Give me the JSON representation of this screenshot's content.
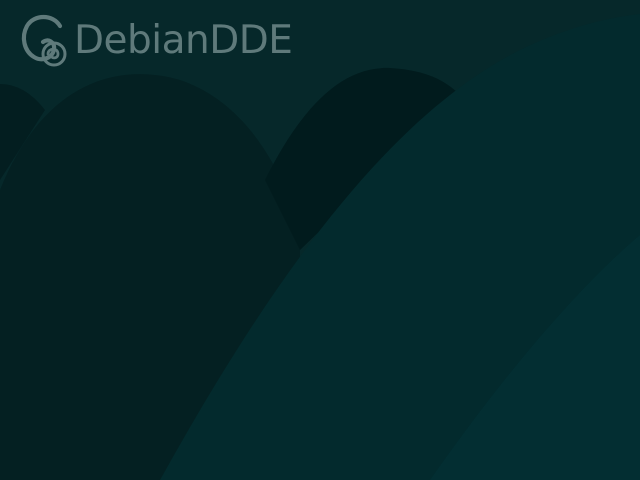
{
  "brand": {
    "name": "DebianDDE",
    "logo_icon": "debian-swirl-icon",
    "color": "#5f7a7b"
  },
  "wallpaper": {
    "name": "teal-curves-wallpaper",
    "colors": {
      "base": "#06282a",
      "dark_arch": "#042022",
      "deep_shadow": "#011b1d",
      "main_curve": "#032a2d",
      "right_edge": "#032e32"
    }
  }
}
